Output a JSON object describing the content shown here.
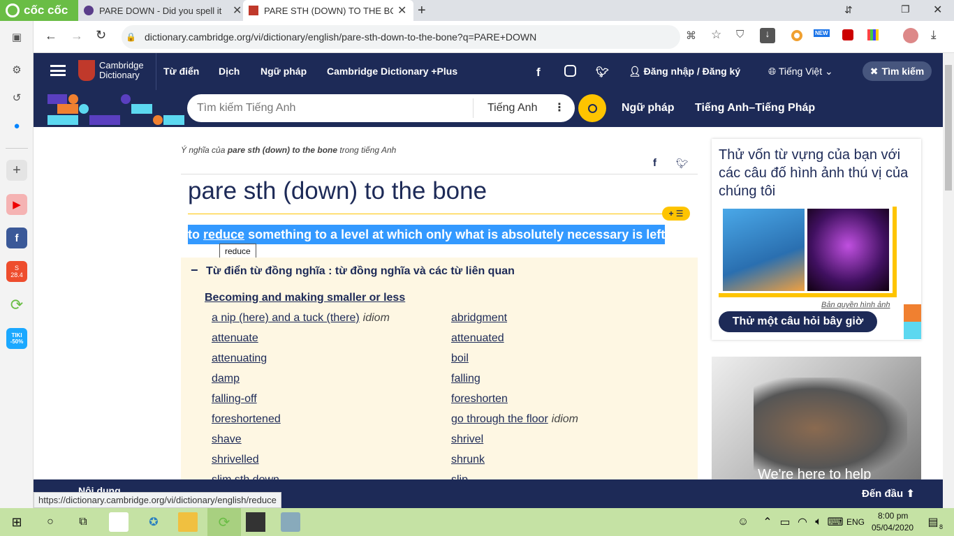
{
  "browser": {
    "brand": "cốc cốc",
    "tabs": [
      {
        "title": "PARE DOWN - Did you spell it"
      },
      {
        "title": "PARE STH (DOWN) TO THE BONE"
      }
    ],
    "url": "dictionary.cambridge.org/vi/dictionary/english/pare-sth-down-to-the-bone?q=PARE+DOWN",
    "status_url": "https://dictionary.cambridge.org/vi/dictionary/english/reduce",
    "new_badge": "NEW"
  },
  "sidebar": {
    "badge_shopee": "28.4",
    "badge_tiki": "TIKI -50%"
  },
  "header": {
    "logo_line1": "Cambridge",
    "logo_line2": "Dictionary",
    "nav": [
      "Từ điển",
      "Dịch",
      "Ngữ pháp",
      "Cambridge Dictionary +Plus"
    ],
    "login": "Đăng nhập / Đăng ký",
    "language": "Tiếng Việt",
    "search_btn": "Tìm kiếm"
  },
  "searchbar": {
    "placeholder": "Tìm kiếm Tiếng Anh",
    "dict": "Tiếng Anh",
    "link1": "Ngữ pháp",
    "link2": "Tiếng Anh–Tiếng Pháp"
  },
  "entry": {
    "breadcrumb_pre": "Ý nghĩa của ",
    "breadcrumb_word": "pare sth (down) to the bone",
    "breadcrumb_post": " trong tiếng Anh",
    "headword": "pare sth (down) to the bone",
    "def_to": "to",
    "def_link": "reduce",
    "def_rest": "something to a level at which only what is absolutely necessary is left",
    "tooltip": "reduce",
    "thes_title": "Từ điển từ đồng nghĩa : từ đồng nghĩa và các từ liên quan",
    "thes_heading": "Becoming and making smaller or less",
    "left_col": [
      {
        "w": "a nip (here) and a tuck (there)",
        "i": "idiom"
      },
      {
        "w": "attenuate",
        "i": ""
      },
      {
        "w": "attenuating",
        "i": ""
      },
      {
        "w": "damp",
        "i": ""
      },
      {
        "w": "falling-off",
        "i": ""
      },
      {
        "w": "foreshortened",
        "i": ""
      },
      {
        "w": "shave",
        "i": ""
      },
      {
        "w": "shrivelled",
        "i": ""
      },
      {
        "w": "slim sth down",
        "i": ""
      }
    ],
    "right_col": [
      {
        "w": "abridgment",
        "i": ""
      },
      {
        "w": "attenuated",
        "i": ""
      },
      {
        "w": "boil",
        "i": ""
      },
      {
        "w": "falling",
        "i": ""
      },
      {
        "w": "foreshorten",
        "i": ""
      },
      {
        "w": "go through the floor",
        "i": "idiom"
      },
      {
        "w": "shrivel",
        "i": ""
      },
      {
        "w": "shrunk",
        "i": ""
      },
      {
        "w": "slip",
        "i": ""
      }
    ]
  },
  "ad": {
    "quiz_text": "Thử vốn từ vựng của bạn với các câu đố hình ảnh thú vị của chúng tôi",
    "copyright": "Bản quyền hình ảnh",
    "quiz_btn": "Thử một câu hỏi bây giờ",
    "help_text": "We're here to help"
  },
  "bottom": {
    "back_top": "Đến đầu",
    "partial": "Nội dung"
  },
  "taskbar": {
    "lang": "ENG",
    "time": "8:00 pm",
    "date": "05/04/2020",
    "notif": "8"
  }
}
